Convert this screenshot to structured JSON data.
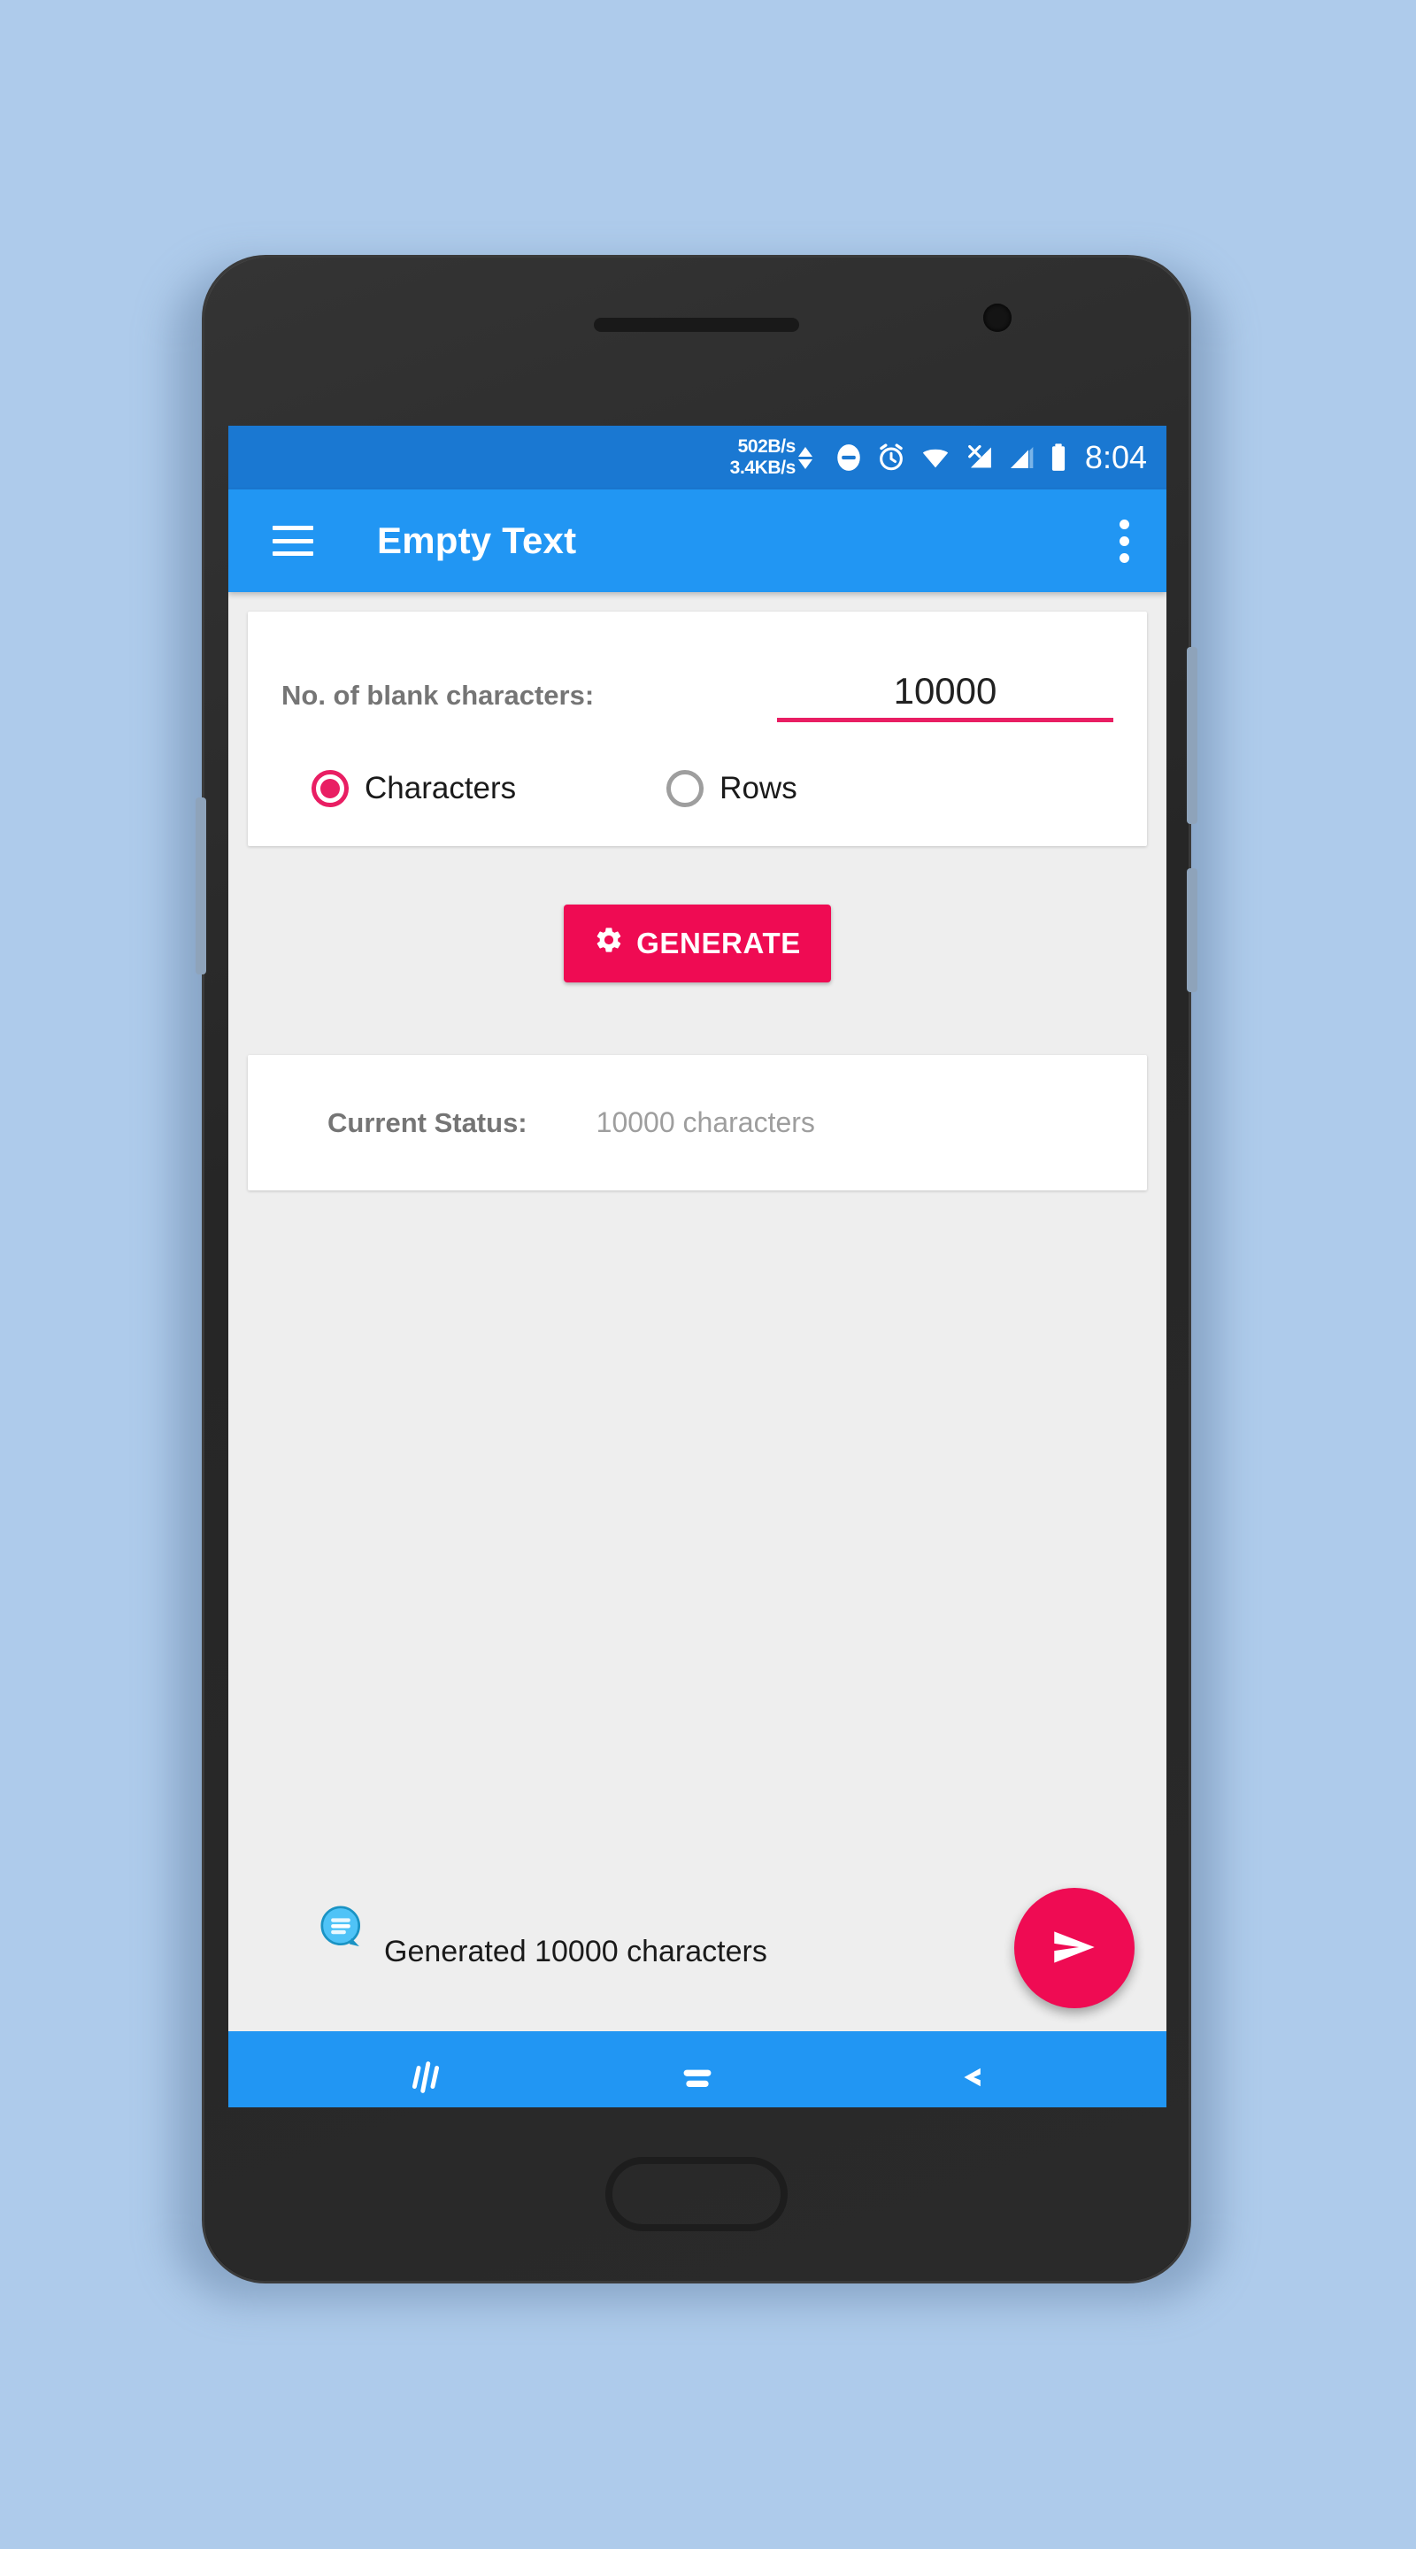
{
  "status_bar": {
    "net_up": "502B/s",
    "net_down": "3.4KB/s",
    "icons": [
      "do-not-disturb-icon",
      "alarm-icon",
      "wifi-icon",
      "signal-no-service-icon",
      "signal-bars-icon",
      "battery-icon"
    ],
    "clock": "8:04"
  },
  "app_bar": {
    "menu_icon": "hamburger-menu-icon",
    "title": "Empty Text",
    "overflow_icon": "more-vert-icon"
  },
  "input_card": {
    "label": "No. of blank characters:",
    "value": "10000",
    "placeholder": "10000",
    "underline_color": "#e91e63",
    "options": [
      {
        "label": "Characters",
        "checked": true
      },
      {
        "label": "Rows",
        "checked": false
      }
    ]
  },
  "generate": {
    "label": "GENERATE",
    "icon": "gear-icon",
    "color": "#ef0b53"
  },
  "status_card": {
    "label": "Current Status:",
    "value": "10000 characters"
  },
  "toast": {
    "icon": "chat-bubble-icon",
    "message": "Generated 10000 characters"
  },
  "fab": {
    "icon": "send-icon",
    "color": "#ef0b53"
  },
  "nav_bar": {
    "buttons": [
      {
        "name": "recents",
        "icon": "recents-icon"
      },
      {
        "name": "home",
        "icon": "home-icon"
      },
      {
        "name": "back",
        "icon": "back-chevron-icon"
      }
    ]
  },
  "theme": {
    "primary": "#2196f3",
    "status_bar": "#1a78d2",
    "accent": "#e91e63",
    "background": "#eeeeee",
    "wallpaper": "#aecbeb"
  }
}
